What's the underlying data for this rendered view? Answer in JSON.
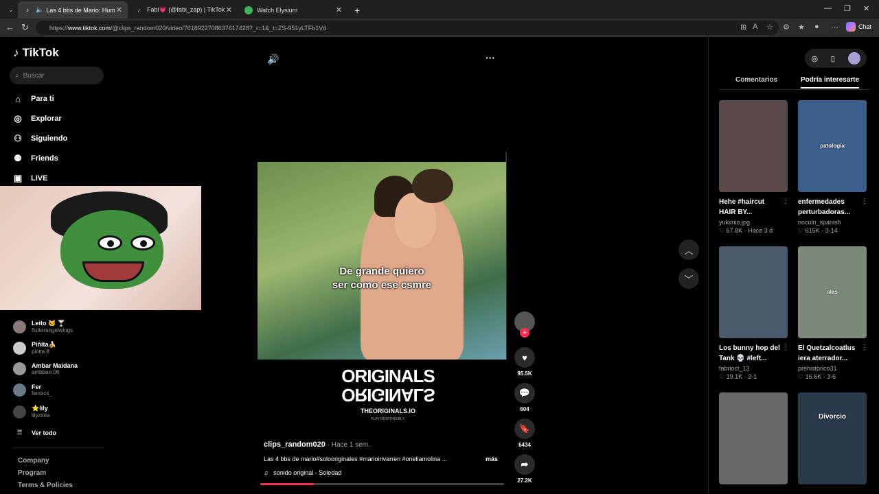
{
  "browser": {
    "tabs": [
      {
        "title": "Las 4 bbs de Mario: Humor y"
      },
      {
        "title": "Fabi💗 (@fabi_zap) | TikTok"
      },
      {
        "title": "Watch Elysium"
      }
    ],
    "url_prefix": "https://",
    "url_domain": "www.tiktok.com",
    "url_path": "/@clips_random020/video/7618922708637617428?_r=1&_t=ZS-951yLTFb1Vd",
    "chat_label": "Chat"
  },
  "sidebar": {
    "brand": "TikTok",
    "search_placeholder": "Buscar",
    "nav": [
      {
        "label": "Para ti",
        "icon": "home-icon"
      },
      {
        "label": "Explorar",
        "icon": "compass-icon"
      },
      {
        "label": "Siguiendo",
        "icon": "following-icon"
      },
      {
        "label": "Friends",
        "icon": "friends-icon"
      },
      {
        "label": "LIVE",
        "icon": "live-icon"
      }
    ],
    "following": [
      {
        "name": "Leito 🐱 🍸",
        "handle": "flutterangelwings"
      },
      {
        "name": "Piñita🍌",
        "handle": "pinita.8"
      },
      {
        "name": "Ambar Maidana",
        "handle": "ambbarr.06"
      },
      {
        "name": "Fer",
        "handle": "fersxcs_"
      },
      {
        "name": "⭐lily",
        "handle": "lilyzxrta"
      }
    ],
    "see_all": "Ver todo",
    "footer": [
      "Company",
      "Program",
      "Terms & Policies"
    ]
  },
  "video": {
    "caption_line1": "De grande quiero",
    "caption_line2": "ser como ese csmre",
    "logo_big_1": "ORIGINALS",
    "logo_big_2": "ORIGINALS",
    "logo_url": "THEORIGINALS.IO",
    "logo_sub": "PLAY RESPONSIBLY.",
    "author": "clips_random020",
    "time": " · Hace 1 sem.",
    "description": "Las 4 bbs de mario#solooriginales #marioirivarren #oneliamolina ...",
    "more": "más",
    "music": "sonido original - Soledad",
    "progress": 0.22
  },
  "actions": {
    "likes": "95.5K",
    "comments": "604",
    "saves": "6434",
    "shares": "27.2K"
  },
  "right_panel": {
    "tabs": [
      "Comentarios",
      "Podría interesarte"
    ],
    "cards": [
      {
        "title": "Hehe #haircut HAIR BY...",
        "author": "yukimio.jpg",
        "likes": "67.8K",
        "date": "Hace 3 d",
        "overlay": "",
        "color": "#5a4a4a"
      },
      {
        "title": "enfermedades perturbadoras...",
        "author": "nocoin_spanish",
        "likes": "615K",
        "date": "3-14",
        "overlay": "patología",
        "color": "#3b5f8a"
      },
      {
        "title": "Los bunny hop del Tank 💀 #left...",
        "author": "fabrioct_13",
        "likes": "19.1K",
        "date": "2-1",
        "overlay": "",
        "color": "#4a5a6a"
      },
      {
        "title": "El Quetzalcoatlus iera aterrador...",
        "author": "prehistorico31",
        "likes": "16.6K",
        "date": "3-6",
        "overlay": "alas",
        "color": "#7c8a7a"
      },
      {
        "title": "",
        "author": "",
        "likes": "",
        "date": "",
        "overlay": "",
        "color": "#6a6a6a"
      },
      {
        "title": "",
        "author": "",
        "likes": "",
        "date": "",
        "overlay": "Divorcio",
        "color": "#2a3a4a"
      }
    ]
  }
}
